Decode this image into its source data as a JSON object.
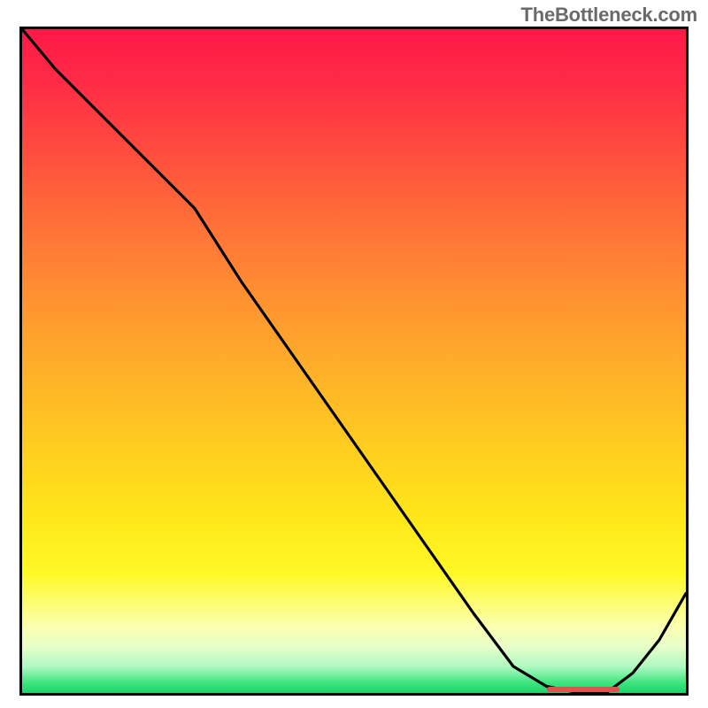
{
  "watermark": "TheBottleneck.com",
  "chart_data": {
    "type": "line",
    "title": "",
    "xlabel": "",
    "ylabel": "",
    "xlim": [
      0,
      100
    ],
    "ylim": [
      0,
      100
    ],
    "grid": false,
    "legend": false,
    "series": [
      {
        "name": "curve",
        "x": [
          0,
          5,
          12,
          19,
          26,
          33,
          40,
          47,
          54,
          61,
          68,
          74,
          79,
          84,
          88,
          92,
          96,
          100
        ],
        "y": [
          100,
          94,
          87,
          80,
          73,
          62,
          52,
          42,
          32,
          22,
          12,
          4,
          1,
          0,
          0,
          3,
          8,
          15
        ]
      }
    ],
    "valley_marker": {
      "x_start": 79,
      "x_end": 90,
      "y": 0.6
    },
    "background_gradient": {
      "top": "#ff1947",
      "bottom": "#1ad36a"
    }
  }
}
